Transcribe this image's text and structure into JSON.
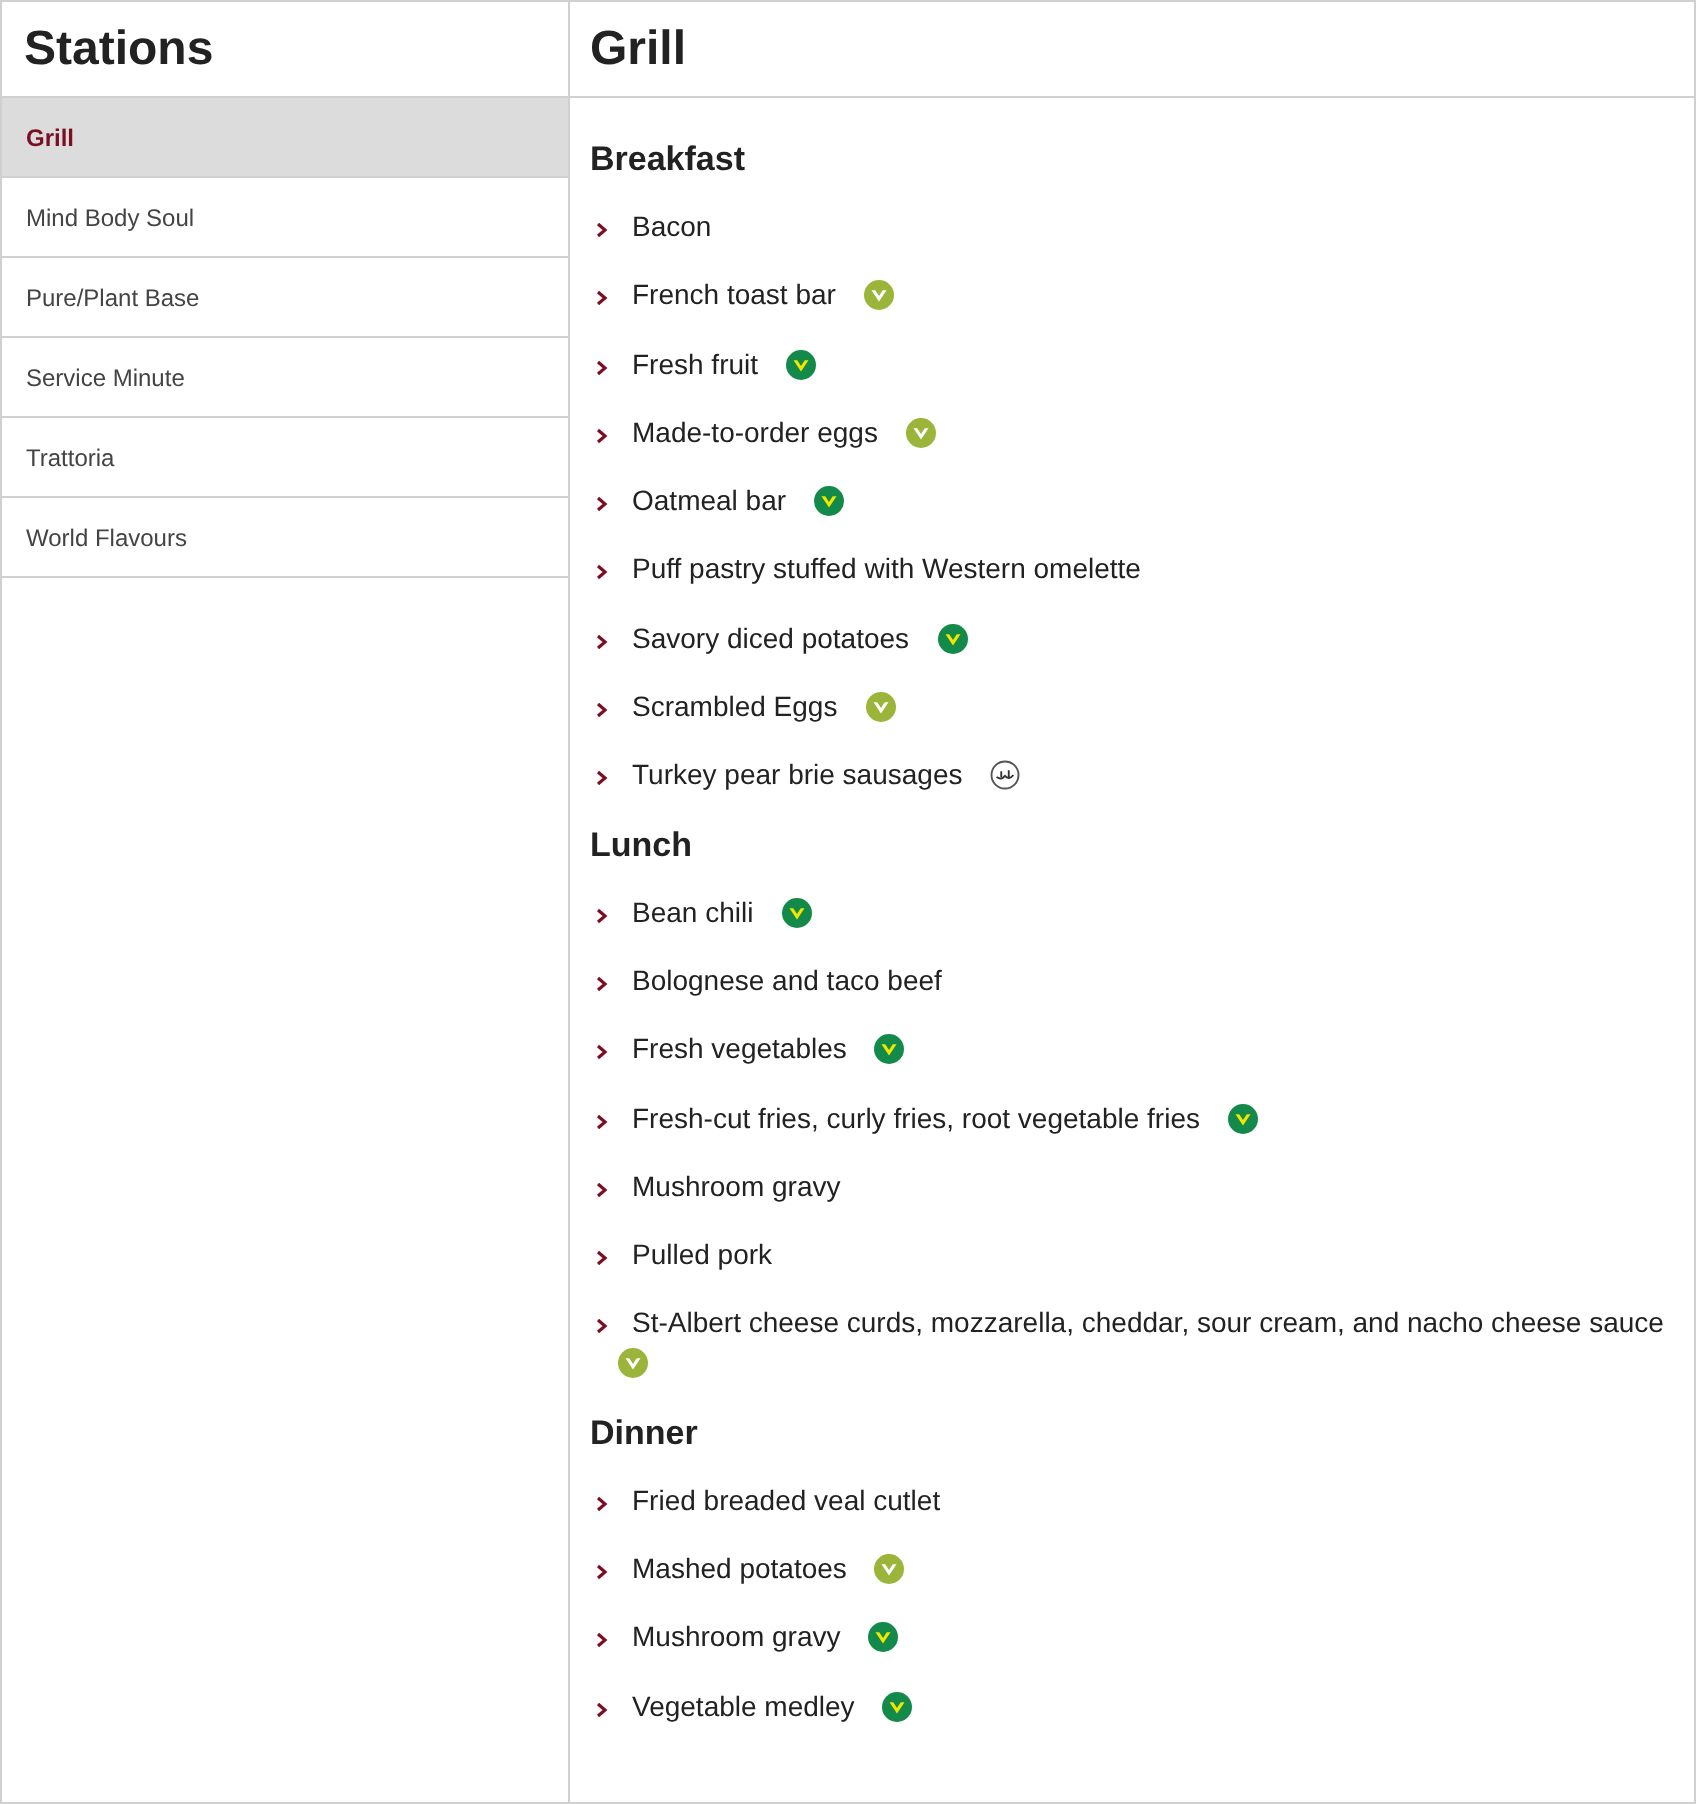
{
  "sidebar": {
    "title": "Stations",
    "items": [
      {
        "label": "Grill",
        "selected": true
      },
      {
        "label": "Mind Body Soul",
        "selected": false
      },
      {
        "label": "Pure/Plant Base",
        "selected": false
      },
      {
        "label": "Service Minute",
        "selected": false
      },
      {
        "label": "Trattoria",
        "selected": false
      },
      {
        "label": "World Flavours",
        "selected": false
      }
    ]
  },
  "content": {
    "title": "Grill",
    "sections": [
      {
        "title": "Breakfast",
        "items": [
          {
            "name": "Bacon",
            "kind": "plain"
          },
          {
            "name": "French toast bar",
            "kind": "vegetarian"
          },
          {
            "name": "Fresh fruit",
            "kind": "vegan"
          },
          {
            "name": "Made-to-order eggs",
            "kind": "vegetarian"
          },
          {
            "name": "Oatmeal bar",
            "kind": "vegan"
          },
          {
            "name": "Puff pastry stuffed with Western omelette",
            "kind": "plain"
          },
          {
            "name": "Savory diced potatoes",
            "kind": "vegan"
          },
          {
            "name": "Scrambled Eggs",
            "kind": "vegetarian"
          },
          {
            "name": "Turkey pear brie sausages",
            "kind": "halal"
          }
        ]
      },
      {
        "title": "Lunch",
        "items": [
          {
            "name": "Bean chili",
            "kind": "vegan"
          },
          {
            "name": "Bolognese and taco beef",
            "kind": "plain"
          },
          {
            "name": "Fresh vegetables",
            "kind": "vegan"
          },
          {
            "name": "Fresh-cut fries, curly fries, root vegetable fries",
            "kind": "vegan"
          },
          {
            "name": "Mushroom gravy",
            "kind": "plain"
          },
          {
            "name": "Pulled pork",
            "kind": "plain"
          },
          {
            "name": "St-Albert cheese curds, mozzarella, cheddar, sour cream, and nacho cheese sauce",
            "kind": "vegetarian"
          }
        ]
      },
      {
        "title": "Dinner",
        "items": [
          {
            "name": "Fried breaded veal cutlet",
            "kind": "plain"
          },
          {
            "name": "Mashed potatoes",
            "kind": "vegetarian"
          },
          {
            "name": "Mushroom gravy",
            "kind": "vegan"
          },
          {
            "name": "Vegetable medley",
            "kind": "vegan"
          }
        ]
      }
    ]
  }
}
